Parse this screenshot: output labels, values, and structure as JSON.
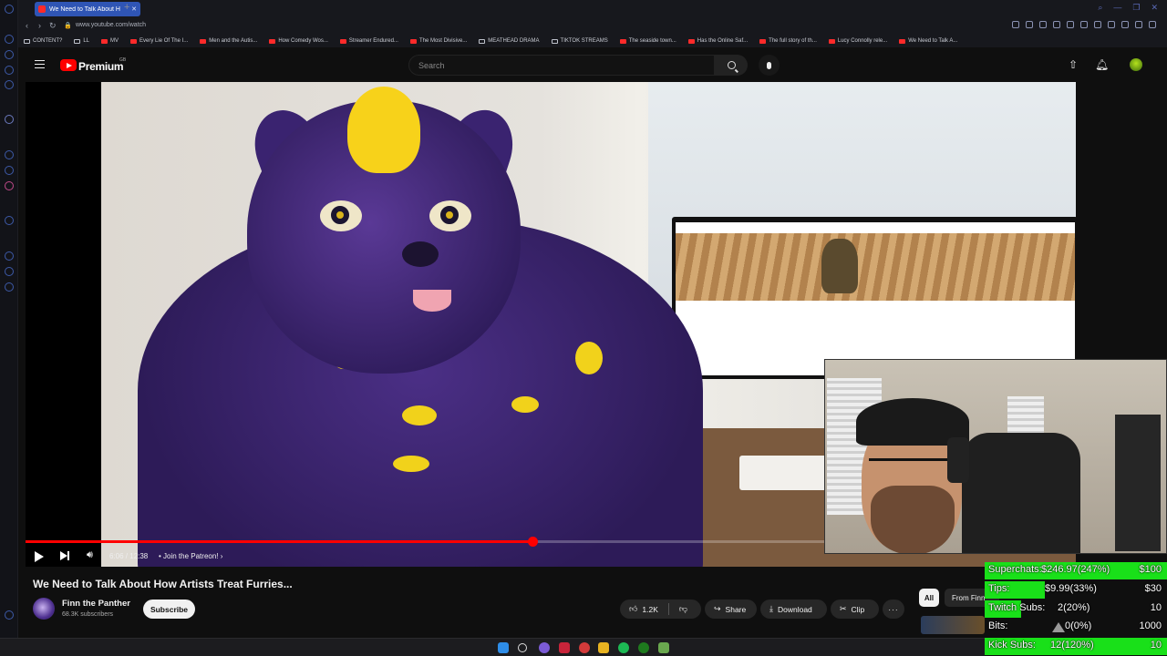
{
  "browser": {
    "tab_title": "We Need to Talk About H",
    "url": "www.youtube.com/watch",
    "bookmarks": [
      {
        "label": "CONTENT?",
        "folder": true
      },
      {
        "label": "LL",
        "folder": true
      },
      {
        "label": "MV",
        "folder": false
      },
      {
        "label": "Every Lie Of The I...",
        "folder": false
      },
      {
        "label": "Men and the Autis...",
        "folder": false
      },
      {
        "label": "How Comedy Wos...",
        "folder": false
      },
      {
        "label": "Streamer Endured...",
        "folder": false
      },
      {
        "label": "The Most Divisive...",
        "folder": false
      },
      {
        "label": "MEATHEAD DRAMA",
        "folder": true
      },
      {
        "label": "TIKTOK STREAMS",
        "folder": true
      },
      {
        "label": "The seaside town...",
        "folder": false
      },
      {
        "label": "Has the Online Saf...",
        "folder": false
      },
      {
        "label": "The full story of th...",
        "folder": false
      },
      {
        "label": "Lucy Connolly rele...",
        "folder": false
      },
      {
        "label": "We Need to Talk A...",
        "folder": false
      }
    ]
  },
  "youtube": {
    "brand": "Premium",
    "country": "GB",
    "search_placeholder": "Search"
  },
  "player": {
    "time": "6:06 / 12:38",
    "chapter": "• Join the Patreon!",
    "progress": 0.483
  },
  "video": {
    "title": "We Need to Talk About How Artists Treat Furries...",
    "channel": "Finn the Panther",
    "subscribers": "68.3K subscribers",
    "subscribe_label": "Subscribe",
    "likes": "1.2K",
    "share_label": "Share",
    "download_label": "Download",
    "clip_label": "Clip",
    "more_label": "···"
  },
  "recommendations": {
    "chip_all": "All",
    "chip_from": "From Finn"
  },
  "overlay": {
    "rows": [
      {
        "label": "Superchats:",
        "value": "$246.97(247%)",
        "goal": "$100",
        "fill": 1.0
      },
      {
        "label": "Tips:",
        "value": "$9.99(33%)",
        "goal": "$30",
        "fill": 0.33
      },
      {
        "label": "Twitch Subs:",
        "value": "2(20%)",
        "goal": "10",
        "fill": 0.2
      },
      {
        "label": "Bits:",
        "value": "0(0%)",
        "goal": "1000",
        "fill": 0.0
      },
      {
        "label": "Kick Subs:",
        "value": "12(120%)",
        "goal": "10",
        "fill": 1.0
      }
    ],
    "color": "#19e019"
  }
}
